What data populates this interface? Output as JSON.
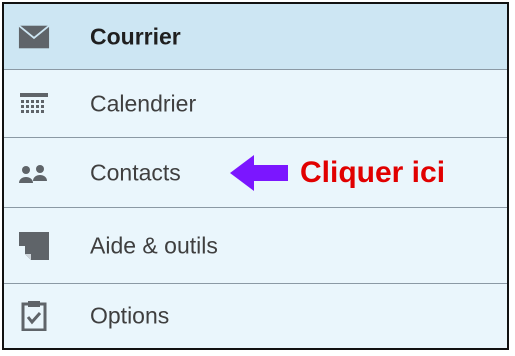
{
  "nav": {
    "items": [
      {
        "label": "Courrier",
        "icon": "mail-icon",
        "active": true
      },
      {
        "label": "Calendrier",
        "icon": "calendar-icon"
      },
      {
        "label": "Contacts",
        "icon": "contacts-icon"
      },
      {
        "label": "Aide & outils",
        "icon": "help-tools-icon"
      },
      {
        "label": "Options",
        "icon": "options-icon"
      }
    ]
  },
  "annotation": {
    "text": "Cliquer ici",
    "arrow_color": "#7b16ff",
    "text_color": "#e10000"
  },
  "colors": {
    "active_row": "#cde6f3",
    "row": "#eaf6fc",
    "divider": "#8b99a4",
    "icon": "#5f6469"
  }
}
